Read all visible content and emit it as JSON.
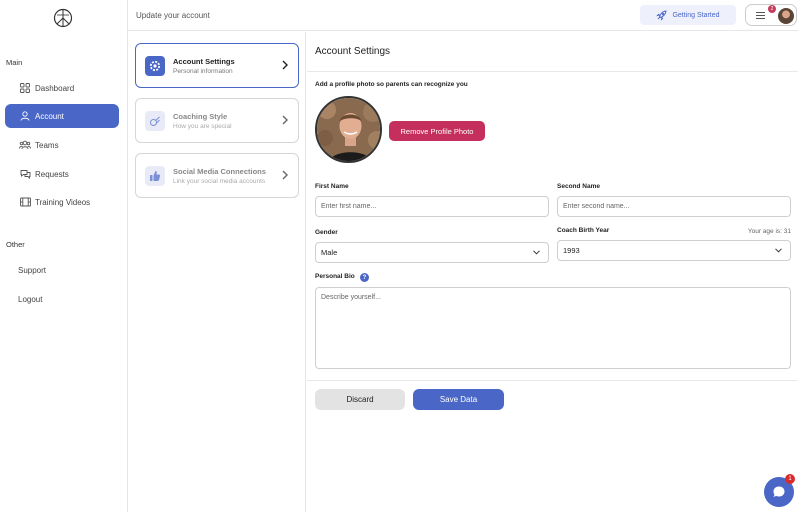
{
  "header": {
    "title": "Update your account",
    "getting_started_label": "Getting Started",
    "notification_count": "2"
  },
  "sidebar": {
    "main_label": "Main",
    "other_label": "Other",
    "items": [
      {
        "label": "Dashboard",
        "icon": "grid-icon"
      },
      {
        "label": "Account",
        "icon": "user-icon",
        "active": true
      },
      {
        "label": "Teams",
        "icon": "users-icon"
      },
      {
        "label": "Requests",
        "icon": "chat-icon"
      },
      {
        "label": "Training Videos",
        "icon": "film-icon"
      }
    ],
    "other_items": [
      {
        "label": "Support"
      },
      {
        "label": "Logout"
      }
    ]
  },
  "settings_nav": [
    {
      "title": "Account Settings",
      "subtitle": "Personal information",
      "icon": "gear-icon",
      "active": true
    },
    {
      "title": "Coaching Style",
      "subtitle": "How you are special",
      "icon": "whistle-icon"
    },
    {
      "title": "Social Media Connections",
      "subtitle": "Link your social media accounts",
      "icon": "thumbs-up-icon"
    }
  ],
  "main": {
    "title": "Account Settings",
    "photo_label": "Add a profile photo so parents can recognize you",
    "remove_photo_label": "Remove Profile Photo",
    "first_name": {
      "label": "First Name",
      "placeholder": "Enter first name...",
      "value": ""
    },
    "second_name": {
      "label": "Second Name",
      "placeholder": "Enter second name...",
      "value": ""
    },
    "gender": {
      "label": "Gender",
      "value": "Male"
    },
    "birth_year": {
      "label": "Coach Birth Year",
      "value": "1993",
      "age_note": "Your age is: 31"
    },
    "bio": {
      "label": "Personal Bio",
      "placeholder": "Describe yourself..."
    },
    "discard_label": "Discard",
    "save_label": "Save Data"
  },
  "chat": {
    "badge_count": "1"
  },
  "colors": {
    "accent": "#4a67c7",
    "danger": "#c52f5d"
  }
}
